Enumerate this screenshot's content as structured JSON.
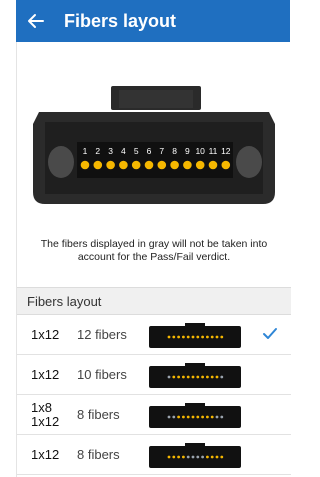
{
  "appbar": {
    "title": "Fibers layout",
    "back_icon": "arrow-left-icon",
    "color": "#1f6fc0"
  },
  "connector": {
    "numbers": [
      "1",
      "2",
      "3",
      "4",
      "5",
      "6",
      "7",
      "8",
      "9",
      "10",
      "11",
      "12"
    ],
    "active_fiber_color": "#f5b700"
  },
  "note": "The fibers displayed in gray will not be taken into account for the Pass/Fail verdict.",
  "section_title": "Fibers layout",
  "rows": [
    {
      "type": "1x12",
      "count": "12 fibers",
      "selected": true,
      "fiber_pattern": [
        "on",
        "on",
        "on",
        "on",
        "on",
        "on",
        "on",
        "on",
        "on",
        "on",
        "on",
        "on"
      ]
    },
    {
      "type": "1x12",
      "count": "10 fibers",
      "selected": false,
      "fiber_pattern": [
        "off",
        "on",
        "on",
        "on",
        "on",
        "on",
        "on",
        "on",
        "on",
        "on",
        "on",
        "off"
      ]
    },
    {
      "type": "1x8\n1x12",
      "count": "8 fibers",
      "selected": false,
      "fiber_pattern": [
        "off",
        "off",
        "on",
        "on",
        "on",
        "on",
        "on",
        "on",
        "on",
        "on",
        "off",
        "off"
      ]
    },
    {
      "type": "1x12",
      "count": "8 fibers",
      "selected": false,
      "fiber_pattern": [
        "on",
        "on",
        "on",
        "on",
        "off",
        "off",
        "off",
        "off",
        "on",
        "on",
        "on",
        "on"
      ]
    }
  ],
  "colors": {
    "selected_check": "#2f86d6",
    "inactive_fiber": "#9aa3ad"
  }
}
